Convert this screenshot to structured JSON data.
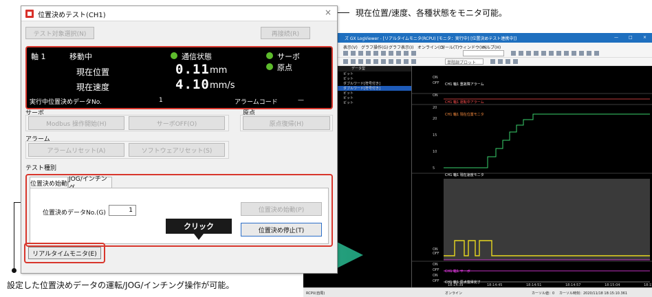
{
  "annotations": {
    "top": "現在位置/速度、各種状態をモニタ可能。",
    "bottom": "設定した位置決めデータの運転/JOG/インチング操作が可能。",
    "click": "クリック"
  },
  "dialog": {
    "title": "位置決めテスト(CH1)",
    "close": "×",
    "select_target": "テスト対象選択(N)",
    "reconnect": "再接続(R)",
    "monitor": {
      "axis": "軸 1",
      "state": "移動中",
      "comm_status": "通信状態",
      "servo": "サーボ",
      "home": "原点",
      "position_label": "現在位置",
      "position_value": "0.11",
      "position_unit": "mm",
      "speed_label": "現在速度",
      "speed_value": "4.10",
      "speed_unit": "mm/s",
      "running_data_label": "実行中位置決めデータNo.",
      "running_data_value": "1",
      "alarm_label": "アラームコード",
      "alarm_value": "—"
    },
    "servo_group": {
      "label": "サーボ",
      "modbus_enable": "Modbus 操作開始(H)",
      "servo_off": "サーボOFF(O)"
    },
    "home_group": {
      "label": "原点",
      "home_return": "原点復帰(H)"
    },
    "alarm_group": {
      "label": "アラーム",
      "alarm_reset": "アラームリセット(A)",
      "software_reset": "ソフトウェアリセット(S)"
    },
    "test_type": {
      "label": "テスト種別",
      "tabs": [
        "位置決め始動",
        "JOG/インチング"
      ],
      "data_no_label": "位置決めデータNo.(G)",
      "data_no_value": "1",
      "start": "位置決め始動(P)",
      "stop": "位置決め停止(T)"
    },
    "realtime_monitor": "リアルタイムモニタ(E)"
  },
  "viewer": {
    "title": "ズ GX LogViewer - [リアルタイムモニタ(RCPU) [モニタ：実行中] [位置決めテスト連携中]]",
    "window_controls": [
      "—",
      "□",
      "×"
    ],
    "menu": [
      "表示(V)",
      "グラフ操作(G)",
      "グラフ表示(I)",
      "オンライン(O)",
      "ツール(T)",
      "ウィンドウ(W)",
      "ヘルプ(H)"
    ],
    "toolbar_combo": "単階調プロット",
    "list_headers": [
      "値",
      "データ型"
    ],
    "list_rows": [
      {
        "name": "原点確定",
        "value": "OFF",
        "type": "ビット",
        "color": "#ffffff"
      },
      {
        "name": "動作中",
        "value": "ON",
        "type": "ビット",
        "color": "#ff5050"
      },
      {
        "name": "現在位置",
        "value": "20",
        "type": "ダブルワード[符号付き]",
        "color": "#ff9040"
      },
      {
        "name": "現在速度",
        "value": "0",
        "type": "ダブルワード[符号付き]",
        "color": "#ffffff",
        "selected": true
      },
      {
        "name": "Modbus",
        "value": "ON",
        "type": "ビット",
        "color": "#ffffff"
      },
      {
        "name": "サーボ",
        "value": "ON",
        "type": "ビット",
        "color": "#ffffff"
      },
      {
        "name": "原点",
        "value": "ON",
        "type": "ビット",
        "color": "#ffffff"
      }
    ],
    "channels": [
      {
        "label": "CH1 軸1 重故障アラーム",
        "top": "ON",
        "bottom": "OFF"
      },
      {
        "label": "CH1 軸1 運転中アラーム",
        "top": "ON",
        "bottom": ""
      },
      {
        "label": "CH1 軸1 現在位置モニタ",
        "top": "20",
        "bottom": ""
      },
      {
        "label": "CH1 軸1 現在速度モニタ",
        "top": "",
        "bottom": ""
      },
      {
        "label": "CH1 軸1 Modbus 操作有効/無効",
        "top": "ON",
        "bottom": "OFF"
      },
      {
        "label": "CH1 軸1 サーボ",
        "top": "ON",
        "bottom": "OFF"
      },
      {
        "label": "CH1 軸1 原点復帰完了",
        "top": "ON",
        "bottom": "OFF"
      }
    ],
    "position_ticks": [
      "20",
      "15",
      "10",
      "5"
    ],
    "time_ticks": [
      "18:14:39",
      "18:14:45",
      "18:14:51",
      "18:14:57",
      "18:15:04",
      "18:15:10"
    ],
    "status": {
      "left": "RCPU(自局)",
      "online": "オンライン",
      "cursor": "カーソル値：0",
      "cursor_time": "カーソル時刻：2020/11/18 18:15:10.361"
    }
  }
}
